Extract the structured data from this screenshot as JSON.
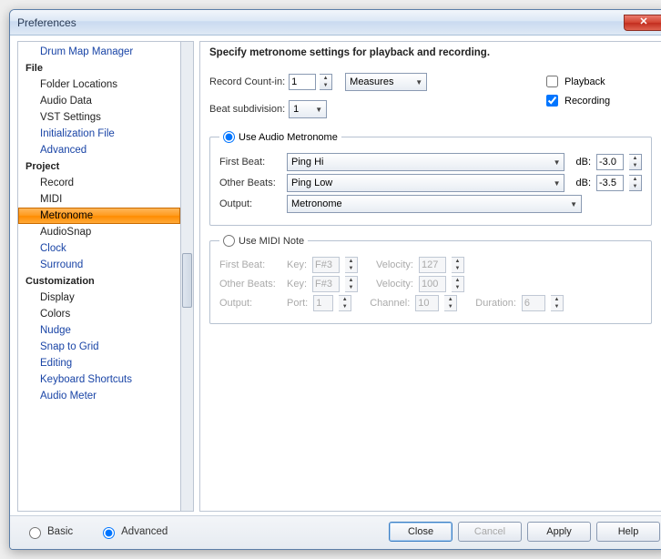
{
  "window": {
    "title": "Preferences"
  },
  "sidebar": {
    "categories": [
      {
        "name": "",
        "items": [
          {
            "label": "Drum Map Manager",
            "link": true
          }
        ]
      },
      {
        "name": "File",
        "items": [
          {
            "label": "Folder Locations"
          },
          {
            "label": "Audio Data"
          },
          {
            "label": "VST Settings"
          },
          {
            "label": "Initialization File",
            "link": true
          },
          {
            "label": "Advanced",
            "link": true
          }
        ]
      },
      {
        "name": "Project",
        "items": [
          {
            "label": "Record"
          },
          {
            "label": "MIDI"
          },
          {
            "label": "Metronome",
            "selected": true
          },
          {
            "label": "AudioSnap"
          },
          {
            "label": "Clock",
            "link": true
          },
          {
            "label": "Surround",
            "link": true
          }
        ]
      },
      {
        "name": "Customization",
        "items": [
          {
            "label": "Display"
          },
          {
            "label": "Colors"
          },
          {
            "label": "Nudge",
            "link": true
          },
          {
            "label": "Snap to Grid",
            "link": true
          },
          {
            "label": "Editing",
            "link": true
          },
          {
            "label": "Keyboard Shortcuts",
            "link": true
          },
          {
            "label": "Audio Meter",
            "link": true
          }
        ]
      }
    ]
  },
  "main": {
    "heading": "Specify metronome settings for playback and recording.",
    "record_countin_label": "Record Count-in:",
    "record_countin_value": "1",
    "record_countin_unit": "Measures",
    "beat_subdiv_label": "Beat subdivision:",
    "beat_subdiv_value": "1",
    "playback_label": "Playback",
    "playback_checked": false,
    "recording_label": "Recording",
    "recording_checked": true,
    "audio_group": {
      "legend": "Use Audio Metronome",
      "selected": true,
      "first_beat_label": "First Beat:",
      "first_beat_value": "Ping Hi",
      "first_beat_db": "-3.0",
      "other_beats_label": "Other Beats:",
      "other_beats_value": "Ping Low",
      "other_beats_db": "-3.5",
      "output_label": "Output:",
      "output_value": "Metronome",
      "db_label": "dB:"
    },
    "midi_group": {
      "legend": "Use MIDI Note",
      "selected": false,
      "first_beat_label": "First Beat:",
      "other_beats_label": "Other Beats:",
      "key_label": "Key:",
      "velocity_label": "Velocity:",
      "fb_key": "F#3",
      "fb_vel": "127",
      "ob_key": "F#3",
      "ob_vel": "100",
      "output_label": "Output:",
      "port_label": "Port:",
      "port_value": "1",
      "channel_label": "Channel:",
      "channel_value": "10",
      "duration_label": "Duration:",
      "duration_value": "6"
    }
  },
  "footer": {
    "basic_label": "Basic",
    "advanced_label": "Advanced",
    "mode_selected": "advanced",
    "buttons": {
      "close": "Close",
      "cancel": "Cancel",
      "apply": "Apply",
      "help": "Help"
    }
  }
}
